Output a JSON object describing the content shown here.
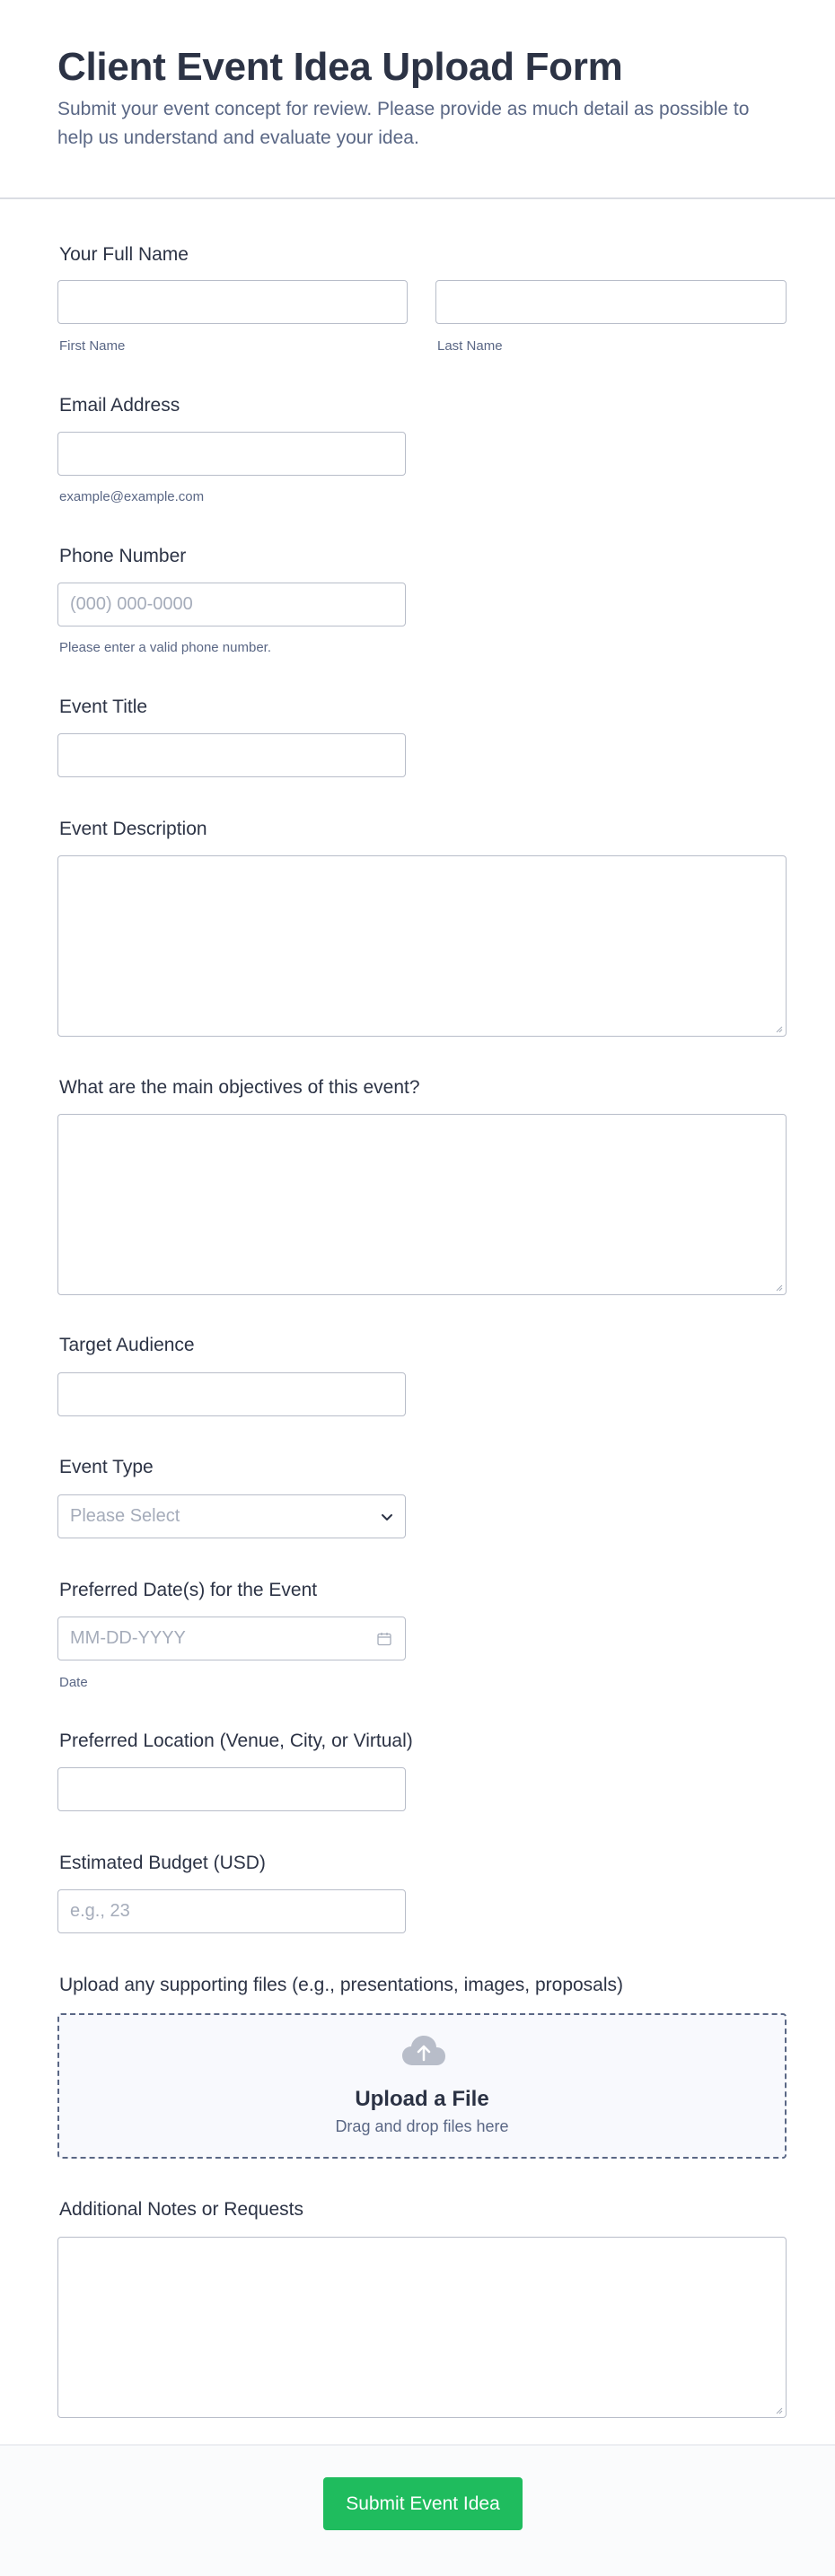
{
  "form": {
    "title": "Client Event Idea Upload Form",
    "subtitle": "Submit your event concept for review. Please provide as much detail as possible to help us understand and evaluate your idea."
  },
  "fields": {
    "full_name": {
      "label": "Your Full Name",
      "first_sublabel": "First Name",
      "last_sublabel": "Last Name",
      "first_value": "",
      "last_value": ""
    },
    "email": {
      "label": "Email Address",
      "sublabel": "example@example.com",
      "value": ""
    },
    "phone": {
      "label": "Phone Number",
      "placeholder": "(000) 000-0000",
      "sublabel": "Please enter a valid phone number."
    },
    "event_title": {
      "label": "Event Title",
      "value": ""
    },
    "event_description": {
      "label": "Event Description",
      "value": ""
    },
    "objectives": {
      "label": "What are the main objectives of this event?",
      "value": ""
    },
    "target_audience": {
      "label": "Target Audience",
      "value": ""
    },
    "event_type": {
      "label": "Event Type",
      "selected": "Please Select",
      "icon": "chevron-down-icon"
    },
    "preferred_dates": {
      "label": "Preferred Date(s) for the Event",
      "placeholder": "MM-DD-YYYY",
      "sublabel": "Date",
      "icon": "calendar-icon"
    },
    "location": {
      "label": "Preferred Location (Venue, City, or Virtual)",
      "value": ""
    },
    "budget": {
      "label": "Estimated Budget (USD)",
      "placeholder": "e.g., 23"
    },
    "upload": {
      "label": "Upload any supporting files (e.g., presentations, images, proposals)",
      "title": "Upload a File",
      "subtitle": "Drag and drop files here",
      "icon": "cloud-upload-icon"
    },
    "notes": {
      "label": "Additional Notes or Requests",
      "value": ""
    }
  },
  "submit": {
    "label": "Submit Event Idea",
    "color": "#1fbc5e"
  },
  "colors": {
    "text": "#2c3345",
    "muted": "#5a6785",
    "border": "#b8bdc9",
    "placeholder": "#a5acba"
  }
}
